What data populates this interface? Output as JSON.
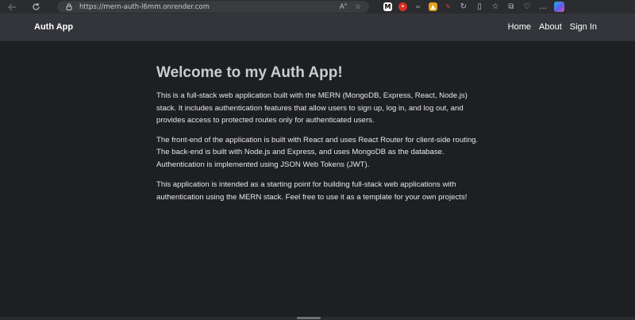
{
  "browser": {
    "url": "https://mern-auth-l6mm.onrender.com"
  },
  "navbar": {
    "brand": "Auth App",
    "links": [
      "Home",
      "About",
      "Sign In"
    ]
  },
  "main": {
    "title": "Welcome to my Auth App!",
    "paragraphs": [
      "This is a full-stack web application built with the MERN (MongoDB, Express, React, Node.js) stack. It includes authentication features that allow users to sign up, log in, and log out, and provides access to protected routes only for authenticated users.",
      "The front-end of the application is built with React and uses React Router for client-side routing. The back-end is built with Node.js and Express, and uses MongoDB as the database. Authentication is implemented using JSON Web Tokens (JWT).",
      "This application is intended as a starting point for building full-stack web applications with authentication using the MERN stack. Feel free to use it as a template for your own projects!"
    ]
  },
  "colors": {
    "page_bg": "#1e1f22",
    "navbar_bg": "#33353a",
    "title": "#c9cccf",
    "text": "#e6e7e8"
  },
  "icons": [
    "back-icon",
    "refresh-icon",
    "lock-icon",
    "read-aloud-icon",
    "favorite-star-icon",
    "extension-icons",
    "split-screen-icon",
    "favorites-icon",
    "collections-icon",
    "heart-icon",
    "more-icon",
    "copilot-icon"
  ]
}
